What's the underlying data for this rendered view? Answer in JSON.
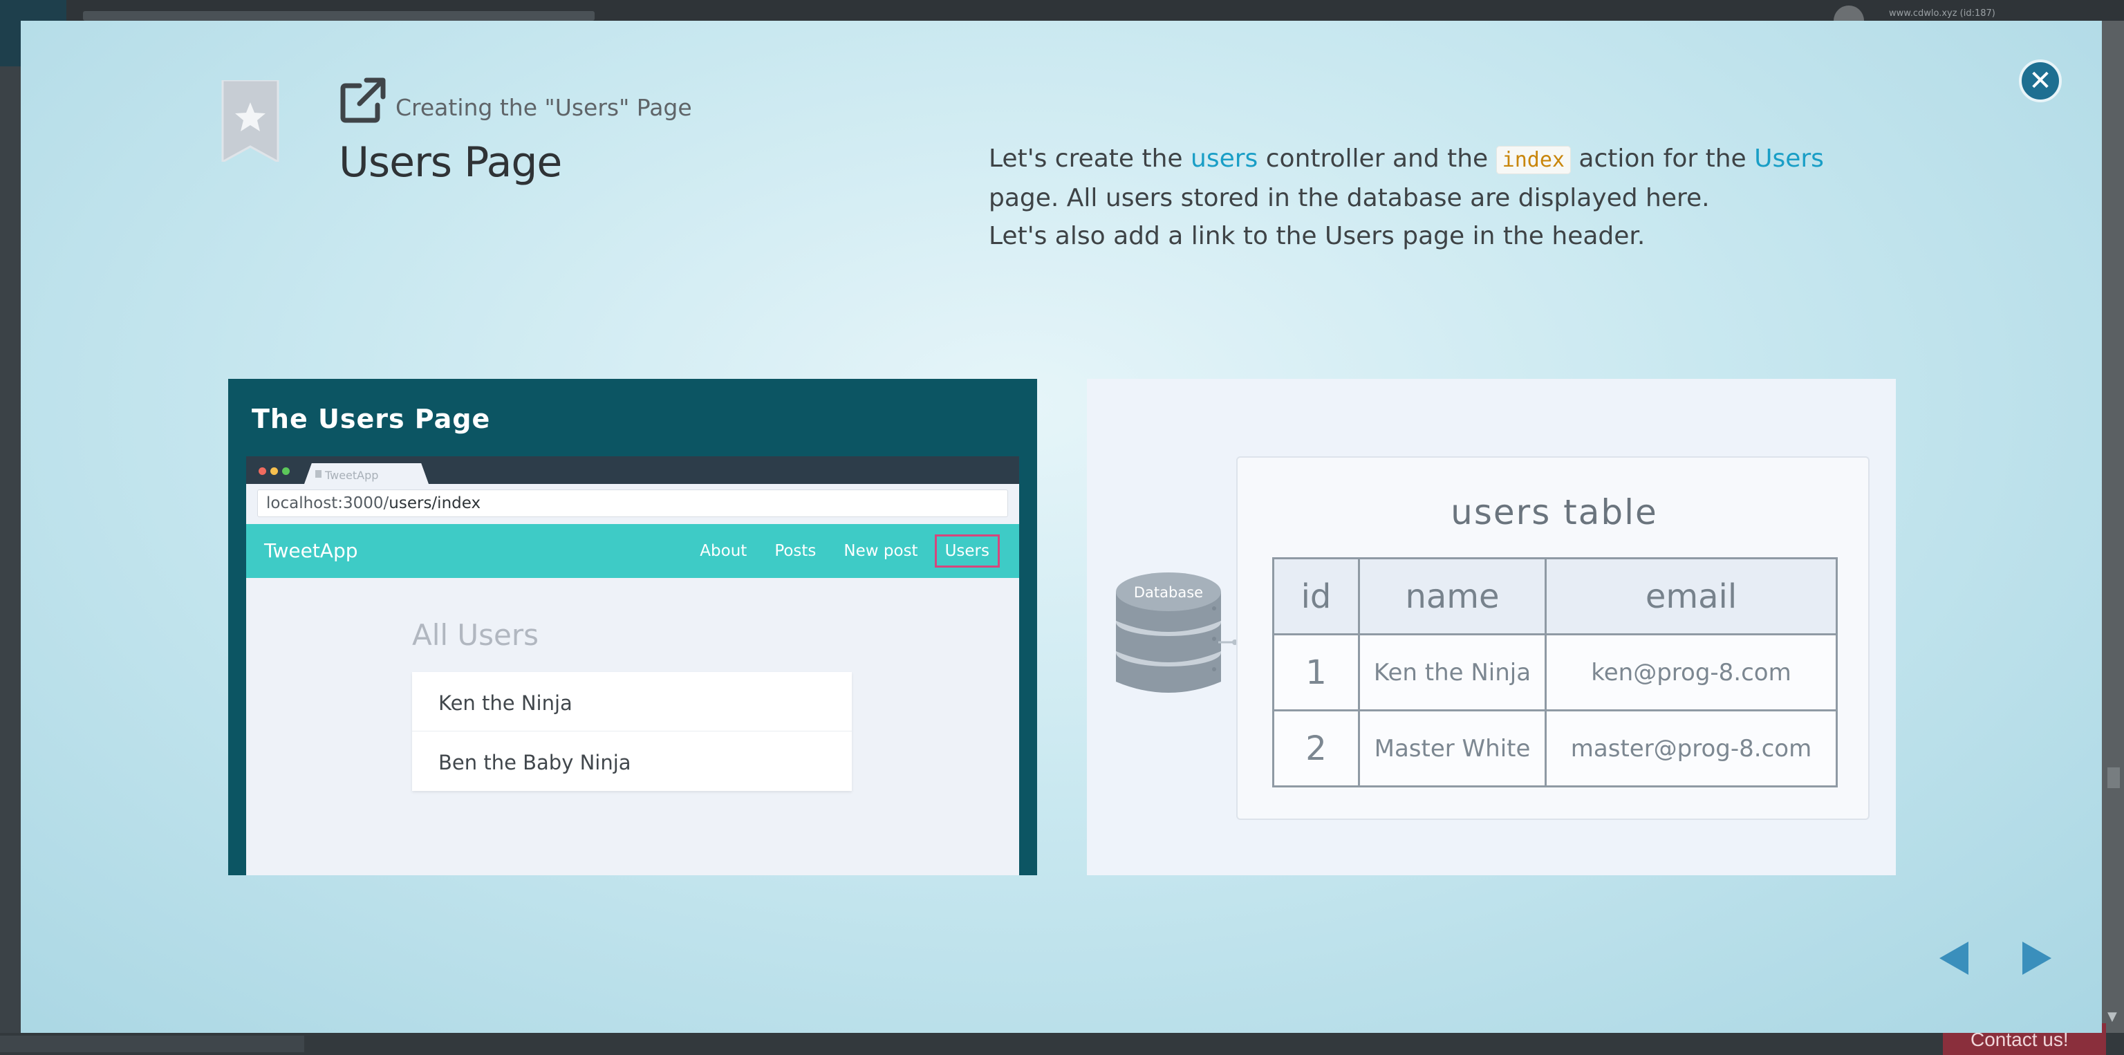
{
  "background_page": {
    "user_menu_text": "www.cdwlo.xyz (id:187)",
    "contact_label": "Contact us!"
  },
  "modal": {
    "subtitle": "Creating the \"Users\" Page",
    "title": "Users Page",
    "description": {
      "line1_part1": "Let's create the ",
      "line1_users": "users",
      "line1_part2": " controller and the ",
      "line1_index": "index",
      "line1_part3": " action for the ",
      "line1_Users": "Users",
      "line2": "page. All users stored in the database are displayed here.",
      "line3": "Let's also add a link to the Users page in the header."
    },
    "close_icon": "close-icon",
    "prev_icon": "triangle-left-icon",
    "next_icon": "triangle-right-icon",
    "colors": {
      "link": "#199ec6",
      "code": "#c9860c",
      "panel_dark": "#0c5563",
      "app_header": "#3ecbc6",
      "close_button": "#1e6f91",
      "active_nav_outline": "#d6467c"
    }
  },
  "left_panel": {
    "title": "The Users Page",
    "browser": {
      "tab_title": "TweetApp",
      "url_prefix": "localhost:3000/",
      "url_path": "users/index"
    },
    "app": {
      "brand": "TweetApp",
      "nav": [
        "About",
        "Posts",
        "New post",
        "Users"
      ],
      "active_nav": "Users",
      "heading": "All Users",
      "users": [
        "Ken the Ninja",
        "Ben the Baby Ninja"
      ]
    }
  },
  "right_panel": {
    "database_label": "Database",
    "table_title": "users table",
    "columns": [
      "id",
      "name",
      "email"
    ],
    "rows": [
      {
        "id": "1",
        "name": "Ken the Ninja",
        "email": "ken@prog-8.com"
      },
      {
        "id": "2",
        "name": "Master White",
        "email": "master@prog-8.com"
      }
    ]
  }
}
